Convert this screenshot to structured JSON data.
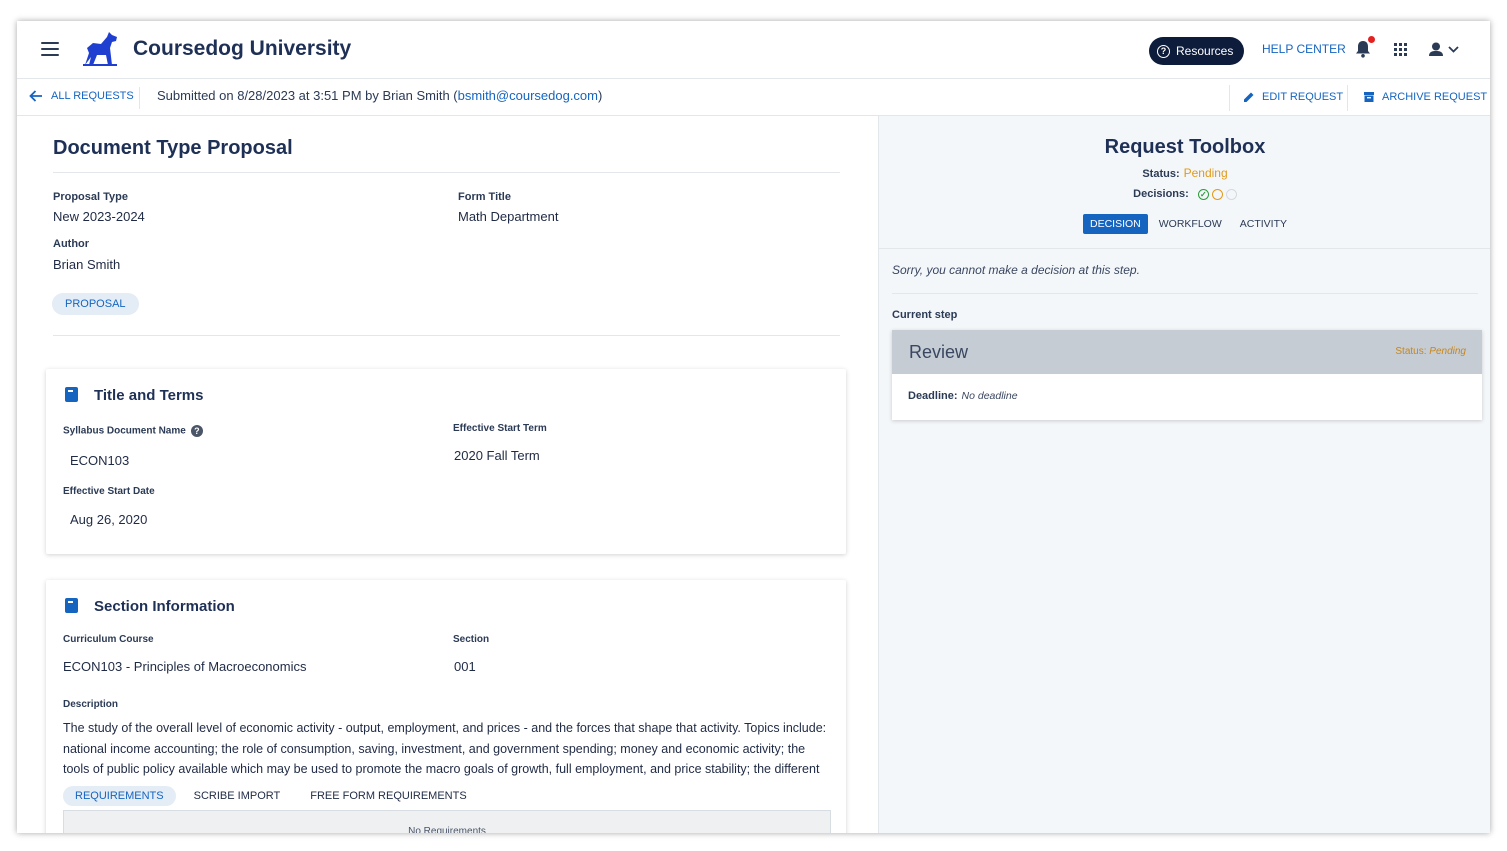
{
  "app": {
    "brand": "Coursedog University",
    "resources_label": "Resources",
    "help_center_label": "HELP CENTER"
  },
  "subbar": {
    "back_label": "ALL REQUESTS",
    "submitted_prefix": "Submitted on 8/28/2023 at 3:51 PM by Brian Smith (",
    "submitted_email": "bsmith@coursedog.com",
    "submitted_suffix": ")",
    "edit_label": "EDIT REQUEST",
    "archive_label": "ARCHIVE REQUEST"
  },
  "proposal": {
    "title": "Document Type Proposal",
    "proposal_type_label": "Proposal Type",
    "proposal_type_value": "New 2023-2024",
    "form_title_label": "Form Title",
    "form_title_value": "Math Department",
    "author_label": "Author",
    "author_value": "Brian Smith",
    "tag": "PROPOSAL"
  },
  "title_terms": {
    "heading": "Title and Terms",
    "doc_name_label": "Syllabus Document Name",
    "doc_name_value": "ECON103",
    "start_term_label": "Effective Start Term",
    "start_term_value": "2020 Fall Term",
    "start_date_label": "Effective Start Date",
    "start_date_value": "Aug 26, 2020"
  },
  "section_info": {
    "heading": "Section Information",
    "course_label": "Curriculum Course",
    "course_value": "ECON103 - Principles of Macroeconomics",
    "section_label": "Section",
    "section_value": "001",
    "description_label": "Description",
    "description_value": "The study of the overall level of economic activity - output, employment, and prices - and the forces that shape that activity. Topics include: national income accounting; the role of consumption, saving, investment, and government spending; money and economic activity; the tools of public policy available which may be used to promote the macro goals of growth, full employment, and price stability; the different",
    "tabs": [
      "REQUIREMENTS",
      "SCRIBE IMPORT",
      "FREE FORM REQUIREMENTS"
    ],
    "no_requirements": "No Requirements"
  },
  "toolbox": {
    "title": "Request Toolbox",
    "status_label": "Status:",
    "status_value": "Pending",
    "decisions_label": "Decisions:",
    "tabs": [
      "DECISION",
      "WORKFLOW",
      "ACTIVITY"
    ],
    "sorry_text": "Sorry, you cannot make a decision at this step.",
    "current_step_label": "Current step",
    "step_name": "Review",
    "step_status_label": "Status:",
    "step_status_value": "Pending",
    "deadline_label": "Deadline:",
    "deadline_value": "No deadline"
  },
  "colors": {
    "accent": "#1565c0",
    "navy": "#0e1c3c",
    "pending": "#e09a1c",
    "notification_dot": "#e52020"
  }
}
